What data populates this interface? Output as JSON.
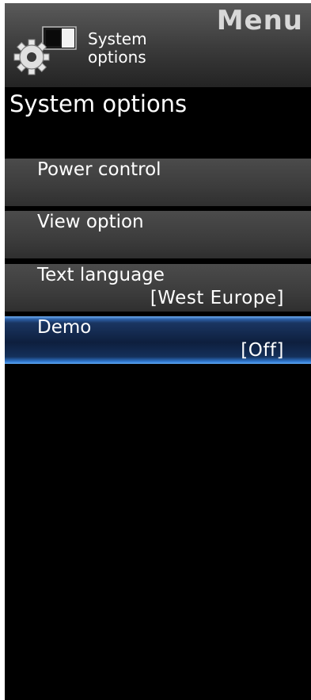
{
  "header": {
    "menu_title": "Menu",
    "category_line1": "System",
    "category_line2": "options",
    "icon": "gear-icon"
  },
  "section_title": "System options",
  "items": [
    {
      "label": "Power control",
      "value": ""
    },
    {
      "label": "View option",
      "value": ""
    },
    {
      "label": "Text language",
      "value": "[West Europe]"
    },
    {
      "label": "Demo",
      "value": "[Off]",
      "selected": true
    }
  ],
  "colors": {
    "background": "#000000",
    "item_background": "#3c3c3c",
    "selected_accent": "#2f78d0",
    "text": "#ffffff"
  }
}
